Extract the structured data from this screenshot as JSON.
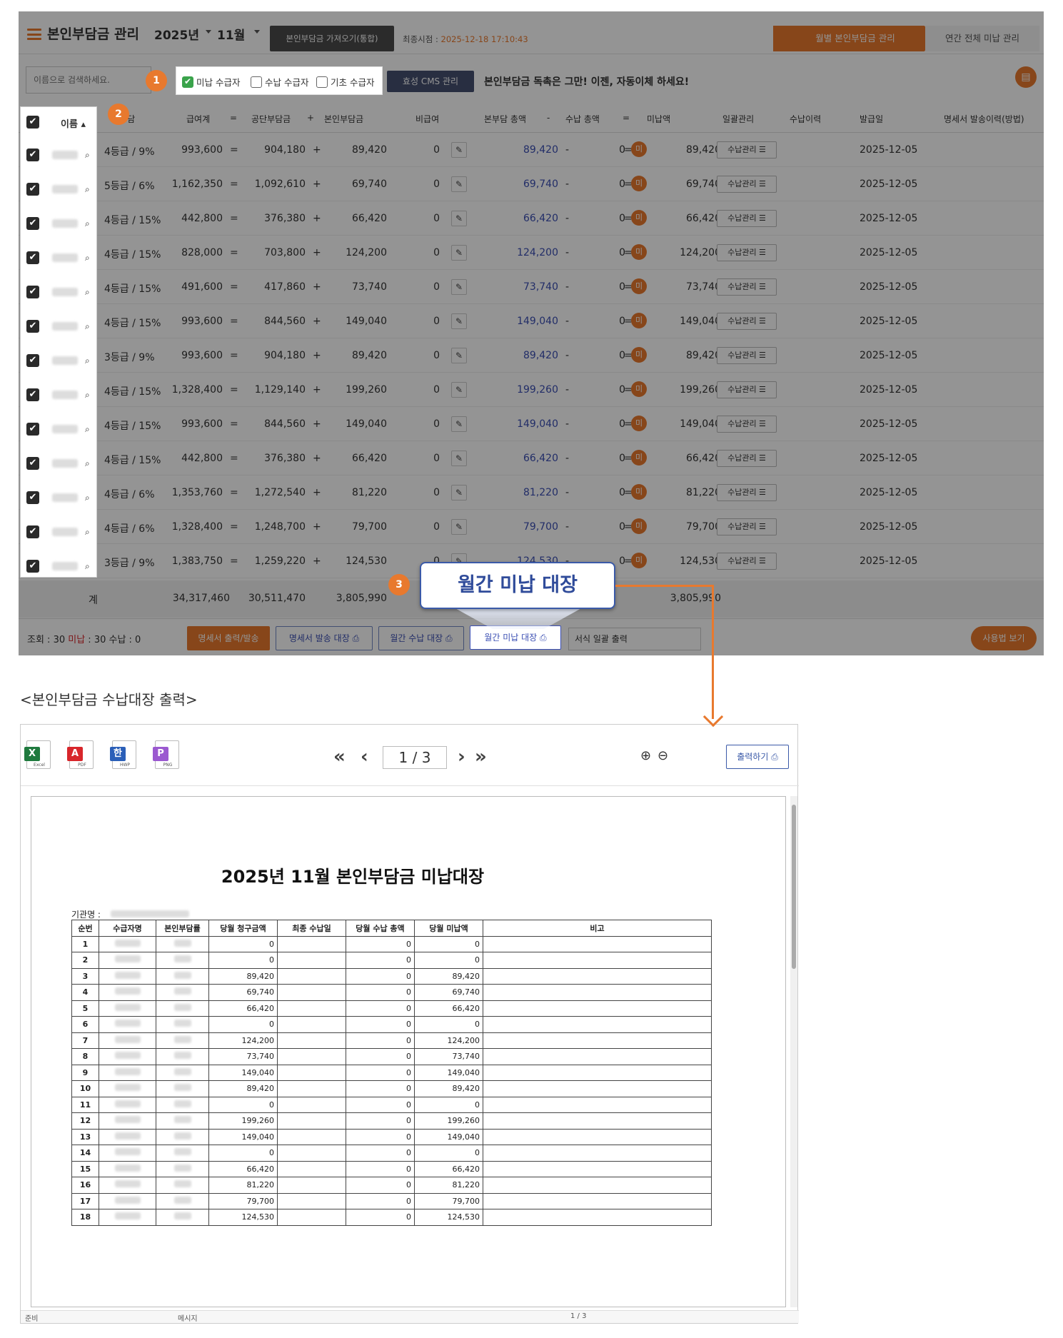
{
  "header": {
    "title": "본인부담금 관리",
    "year": "2025년",
    "month": "11월",
    "fetch_button": "본인부담금 가져오기(통합)",
    "last_sync_label": "최종시점 : ",
    "last_sync_value": "2025-12-18 17:10:43",
    "tab_monthly": "월별 본인부담금 관리",
    "tab_annual": "연간 전체 미납 관리"
  },
  "filters": {
    "search_placeholder": "이름으로 검색하세요.",
    "unpaid": "미납 수급자",
    "paid": "수납 수급자",
    "basic": "기초 수급자",
    "cms_button": "효성 CMS 관리",
    "promo": "본인부담금 독촉은 그만! 이젠, 자동이체 하세요!"
  },
  "annotations": {
    "one": "1",
    "two": "2",
    "three": "3",
    "callout": "월간 미납 대장"
  },
  "columns": {
    "name": "이름",
    "grade": "본부담",
    "total": "급여계",
    "eq1": "=",
    "public": "공단부담금",
    "plus1": "+",
    "own": "본인부담금",
    "nonpay": "비급여",
    "own_total": "본부담 총액",
    "minus1": "-",
    "paid_total": "수납 총액",
    "eq2": "=",
    "unpaid": "미납액",
    "manage": "일괄관리",
    "history": "수납이력",
    "issue_date": "발급일",
    "statement": "명세서 발송이력(방법)"
  },
  "rows": [
    {
      "grade": "4등급 /  9%",
      "total": "993,600",
      "public": "904,180",
      "own": "89,420",
      "nonpay": "0",
      "own_total": "89,420",
      "paid": "0",
      "unpaid": "89,420",
      "date": "2025-12-05"
    },
    {
      "grade": "5등급 /  6%",
      "total": "1,162,350",
      "public": "1,092,610",
      "own": "69,740",
      "nonpay": "0",
      "own_total": "69,740",
      "paid": "0",
      "unpaid": "69,740",
      "date": "2025-12-05"
    },
    {
      "grade": "4등급 / 15%",
      "total": "442,800",
      "public": "376,380",
      "own": "66,420",
      "nonpay": "0",
      "own_total": "66,420",
      "paid": "0",
      "unpaid": "66,420",
      "date": "2025-12-05"
    },
    {
      "grade": "4등급 / 15%",
      "total": "828,000",
      "public": "703,800",
      "own": "124,200",
      "nonpay": "0",
      "own_total": "124,200",
      "paid": "0",
      "unpaid": "124,200",
      "date": "2025-12-05"
    },
    {
      "grade": "4등급 / 15%",
      "total": "491,600",
      "public": "417,860",
      "own": "73,740",
      "nonpay": "0",
      "own_total": "73,740",
      "paid": "0",
      "unpaid": "73,740",
      "date": "2025-12-05"
    },
    {
      "grade": "4등급 / 15%",
      "total": "993,600",
      "public": "844,560",
      "own": "149,040",
      "nonpay": "0",
      "own_total": "149,040",
      "paid": "0",
      "unpaid": "149,040",
      "date": "2025-12-05"
    },
    {
      "grade": "3등급 /  9%",
      "total": "993,600",
      "public": "904,180",
      "own": "89,420",
      "nonpay": "0",
      "own_total": "89,420",
      "paid": "0",
      "unpaid": "89,420",
      "date": "2025-12-05"
    },
    {
      "grade": "4등급 / 15%",
      "total": "1,328,400",
      "public": "1,129,140",
      "own": "199,260",
      "nonpay": "0",
      "own_total": "199,260",
      "paid": "0",
      "unpaid": "199,260",
      "date": "2025-12-05"
    },
    {
      "grade": "4등급 / 15%",
      "total": "993,600",
      "public": "844,560",
      "own": "149,040",
      "nonpay": "0",
      "own_total": "149,040",
      "paid": "0",
      "unpaid": "149,040",
      "date": "2025-12-05"
    },
    {
      "grade": "4등급 / 15%",
      "total": "442,800",
      "public": "376,380",
      "own": "66,420",
      "nonpay": "0",
      "own_total": "66,420",
      "paid": "0",
      "unpaid": "66,420",
      "date": "2025-12-05"
    },
    {
      "grade": "4등급 /  6%",
      "total": "1,353,760",
      "public": "1,272,540",
      "own": "81,220",
      "nonpay": "0",
      "own_total": "81,220",
      "paid": "0",
      "unpaid": "81,220",
      "date": "2025-12-05"
    },
    {
      "grade": "4등급 /  6%",
      "total": "1,328,400",
      "public": "1,248,700",
      "own": "79,700",
      "nonpay": "0",
      "own_total": "79,700",
      "paid": "0",
      "unpaid": "79,700",
      "date": "2025-12-05"
    },
    {
      "grade": "3등급 /  9%",
      "total": "1,383,750",
      "public": "1,259,220",
      "own": "124,530",
      "nonpay": "0",
      "own_total": "124,530",
      "paid": "0",
      "unpaid": "124,530",
      "date": "2025-12-05"
    }
  ],
  "row_labels": {
    "mi": "미",
    "manage_btn": "수납관리"
  },
  "summary": {
    "label": "계",
    "total": "34,317,460",
    "public": "30,511,470",
    "own": "3,805,990",
    "unpaid": "3,805,990"
  },
  "footer": {
    "counts_prefix": "조회 : 30  ",
    "unpaid_word": "미납",
    "counts_suffix": " : 30  수납 : 0",
    "btn_statement_out": "명세서 출력/발송",
    "btn_statement_ledger": "명세서 발송 대장",
    "btn_monthly_paid": "월간 수납 대장",
    "btn_monthly_unpaid": "월간 미납 대장",
    "batch_select": "서식 일괄 출력",
    "btn_guide": "사용법 보기"
  },
  "section_title": "<본인부담금 수납대장 출력>",
  "viewer": {
    "export_icons": [
      {
        "tag": "X",
        "cap": "Excel",
        "color": "#1f7a3e"
      },
      {
        "tag": "A",
        "cap": "PDF",
        "color": "#d8262b"
      },
      {
        "tag": "한",
        "cap": "HWP",
        "color": "#2b5fb8"
      },
      {
        "tag": "P",
        "cap": "PNG",
        "color": "#9b59d0"
      }
    ],
    "page": "1 / 3",
    "print_button": "출력하기",
    "status_left": "준비",
    "status_mid": "메시지",
    "status_page": "1 / 3"
  },
  "report": {
    "title": "2025년 11월 본인부담금 미납대장",
    "org_label": "기관명 :",
    "headers": [
      "순번",
      "수급자명",
      "본인부담률",
      "당월 청구금액",
      "최종 수납일",
      "당월 수납 총액",
      "당월 미납액",
      "비고"
    ],
    "rows": [
      {
        "no": "1",
        "bill": "0",
        "paid": "0",
        "unpaid": "0"
      },
      {
        "no": "2",
        "bill": "0",
        "paid": "0",
        "unpaid": "0"
      },
      {
        "no": "3",
        "bill": "89,420",
        "paid": "0",
        "unpaid": "89,420"
      },
      {
        "no": "4",
        "bill": "69,740",
        "paid": "0",
        "unpaid": "69,740"
      },
      {
        "no": "5",
        "bill": "66,420",
        "paid": "0",
        "unpaid": "66,420"
      },
      {
        "no": "6",
        "bill": "0",
        "paid": "0",
        "unpaid": "0"
      },
      {
        "no": "7",
        "bill": "124,200",
        "paid": "0",
        "unpaid": "124,200"
      },
      {
        "no": "8",
        "bill": "73,740",
        "paid": "0",
        "unpaid": "73,740"
      },
      {
        "no": "9",
        "bill": "149,040",
        "paid": "0",
        "unpaid": "149,040"
      },
      {
        "no": "10",
        "bill": "89,420",
        "paid": "0",
        "unpaid": "89,420"
      },
      {
        "no": "11",
        "bill": "0",
        "paid": "0",
        "unpaid": "0"
      },
      {
        "no": "12",
        "bill": "199,260",
        "paid": "0",
        "unpaid": "199,260"
      },
      {
        "no": "13",
        "bill": "149,040",
        "paid": "0",
        "unpaid": "149,040"
      },
      {
        "no": "14",
        "bill": "0",
        "paid": "0",
        "unpaid": "0"
      },
      {
        "no": "15",
        "bill": "66,420",
        "paid": "0",
        "unpaid": "66,420"
      },
      {
        "no": "16",
        "bill": "81,220",
        "paid": "0",
        "unpaid": "81,220"
      },
      {
        "no": "17",
        "bill": "79,700",
        "paid": "0",
        "unpaid": "79,700"
      },
      {
        "no": "18",
        "bill": "124,530",
        "paid": "0",
        "unpaid": "124,530"
      }
    ]
  }
}
